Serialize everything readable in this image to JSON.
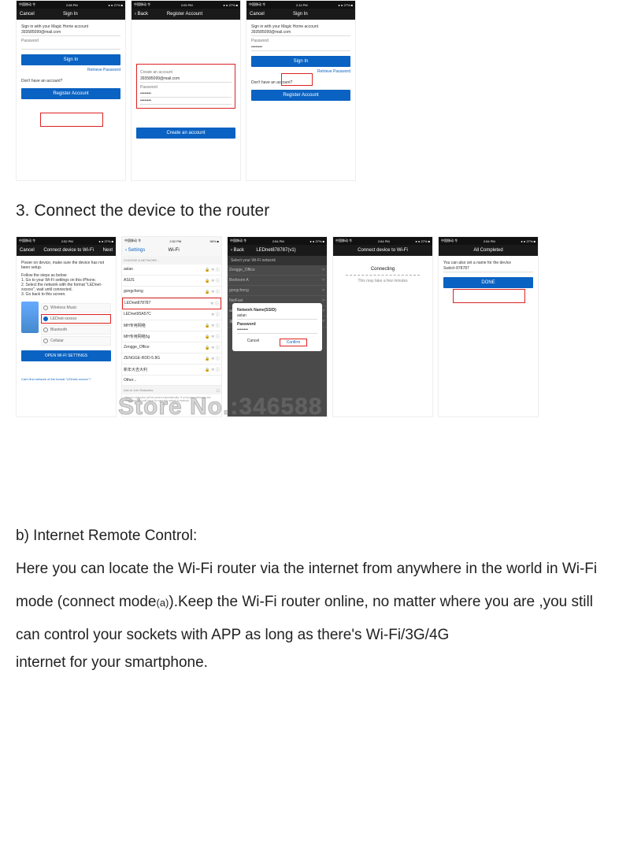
{
  "status": {
    "carrier": "中国移动 令",
    "time_a": "2:08 PM",
    "time_b": "2:09 PM",
    "time_c": "2:11 PM",
    "time_d": "2:52 PM",
    "time_e": "2:54 PM",
    "batt": "● ● 27% ■"
  },
  "row1": {
    "p1": {
      "nav_l": "Cancel",
      "nav_c": "Sign In",
      "prompt": "Sign in with your Magic Home account",
      "email": "393585099@mail.com",
      "pw_label": "Password",
      "signin": "Sign In",
      "retrieve": "Retrieve Password",
      "noacct": "Don't have an account?",
      "reg": "Register Account"
    },
    "p2": {
      "nav_l": "‹ Back",
      "nav_c": "Register Account",
      "create_lbl": "Create an account",
      "email": "393585099@mail.com",
      "pw_label": "Password",
      "pw_dots": "••••••••",
      "pw_dots2": "••••••••",
      "create_btn": "Create an account"
    },
    "p3": {
      "nav_l": "Cancel",
      "nav_c": "Sign In",
      "prompt": "Sign in with your Magic Home account",
      "email": "393585099@mail.com",
      "pw_label": "Password",
      "pw_dots": "••••••••",
      "signin": "Sign In",
      "retrieve": "Retrieve Password",
      "noacct": "Don't have an account?",
      "reg": "Register Account"
    }
  },
  "step3_title": "3. Connect the device to the router",
  "row2": {
    "p1": {
      "nav_l": "Cancel",
      "nav_c": "Connect device to Wi-Fi",
      "nav_r": "Next",
      "l1": "Power on device, make sure the device has not been setup.",
      "l2": "Follow the steps as below:",
      "s1": "1. Go to your Wi-Fi settings on this iPhone.",
      "s2": "2. Select the network with the format \"LEDnet-xxxxxx\", wait until connected.",
      "s3": "3. Go back to this screen.",
      "wifi_sel": "LEDnet-xxxxxx",
      "open_btn": "OPEN WI-FI SETTINGS",
      "foot": "Can't find network of the format \"LEDnet-xxxxxx\"?"
    },
    "p2": {
      "nav_l": "‹ Settings",
      "nav_c": "Wi-Fi",
      "choose": "CHOOSE A NETWORK...",
      "nets": [
        "aslan",
        "ASUS",
        "gongcheng",
        "LEDnet878787",
        "LEDnet95A57C",
        "MH专用网络",
        "MH专用网络5g",
        "Zengge_Office",
        "ZENGGE-RDD-5.8G",
        "新年大吉大利",
        "Other..."
      ],
      "ask": "Ask to Join Networks",
      "foot": "Known networks will be joined automatically. If no known networks are available, you will have to manually select a network."
    },
    "p3": {
      "nav_l": "‹ Back",
      "nav_c": "LEDnet878787(v1)",
      "sel": "Select your Wi-Fi network",
      "nets": [
        "Zengge_Office",
        "Bedroom A",
        "gongcheng",
        "NetFast",
        "aslan",
        "海思网络"
      ],
      "modal_ssid_lbl": "Network Name(SSID)",
      "modal_ssid": "aslan",
      "modal_pw_lbl": "Password",
      "modal_pw": "••••••••",
      "cancel": "Cancel",
      "confirm": "Confirm"
    },
    "p4": {
      "nav_c": "Connect device to Wi-Fi",
      "title": "Connecting",
      "sub": "This may take a few minutes"
    },
    "p5": {
      "nav_c": "All Completed",
      "msg": "You can also set a name for the device",
      "name": "Switch 878787",
      "done": "DONE"
    }
  },
  "watermark": "Store No.:346588",
  "section_b_title": "b) Internet Remote Control:",
  "section_b_body_1": "Here you can locate the Wi-Fi router via the internet from anywhere in the world in Wi-Fi mode (connect mode",
  "section_b_body_sub": "(a)",
  "section_b_body_2": ").Keep the Wi-Fi router online, no matter where you are ,you still can control your sockets with APP as long as there's Wi-Fi/3G/4G",
  "section_b_body_3": "internet for your smartphone."
}
